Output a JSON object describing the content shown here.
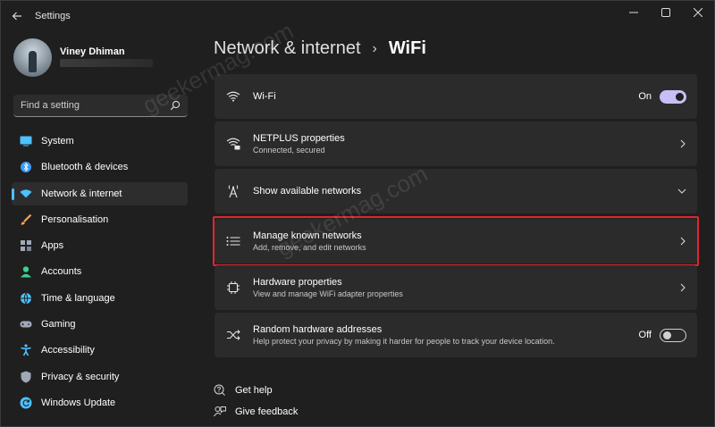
{
  "window": {
    "title": "Settings"
  },
  "profile": {
    "name": "Viney Dhiman"
  },
  "search": {
    "placeholder": "Find a setting"
  },
  "sidebar": {
    "items": [
      {
        "label": "System",
        "icon": "system-icon",
        "color": "#4cc2ff"
      },
      {
        "label": "Bluetooth & devices",
        "icon": "bluetooth-icon",
        "color": "#3a9cf5"
      },
      {
        "label": "Network & internet",
        "icon": "wifi-icon",
        "color": "#4cc2ff",
        "active": true
      },
      {
        "label": "Personalisation",
        "icon": "brush-icon",
        "color": "#f0a35a"
      },
      {
        "label": "Apps",
        "icon": "apps-icon",
        "color": "#a0a8b8"
      },
      {
        "label": "Accounts",
        "icon": "accounts-icon",
        "color": "#3ecf8e"
      },
      {
        "label": "Time & language",
        "icon": "globe-icon",
        "color": "#4cc2ff"
      },
      {
        "label": "Gaming",
        "icon": "gamepad-icon",
        "color": "#a0a8b8"
      },
      {
        "label": "Accessibility",
        "icon": "accessibility-icon",
        "color": "#4cc2ff"
      },
      {
        "label": "Privacy & security",
        "icon": "shield-icon",
        "color": "#a0a8b8"
      },
      {
        "label": "Windows Update",
        "icon": "update-icon",
        "color": "#4cc2ff"
      }
    ]
  },
  "breadcrumb": {
    "parent": "Network & internet",
    "separator": "›",
    "current": "WiFi"
  },
  "cards": {
    "wifi": {
      "title": "Wi-Fi",
      "toggle_label": "On",
      "toggle_state": "on"
    },
    "netplus": {
      "title": "NETPLUS properties",
      "subtitle": "Connected, secured"
    },
    "show_networks": {
      "title": "Show available networks"
    },
    "manage_known": {
      "title": "Manage known networks",
      "subtitle": "Add, remove, and edit networks"
    },
    "hardware": {
      "title": "Hardware properties",
      "subtitle": "View and manage WiFi adapter properties"
    },
    "random_hw": {
      "title": "Random hardware addresses",
      "subtitle": "Help protect your privacy by making it harder for people to track your device location.",
      "toggle_label": "Off",
      "toggle_state": "off"
    }
  },
  "links": {
    "help": "Get help",
    "feedback": "Give feedback"
  },
  "watermark": {
    "text": "geekermag.com"
  },
  "colors": {
    "accent": "#4cc2ff",
    "toggle_on": "#c8bdf5",
    "highlight_border": "#e0262f",
    "card_bg": "#2b2b2b",
    "window_bg": "#1f1f1f"
  }
}
